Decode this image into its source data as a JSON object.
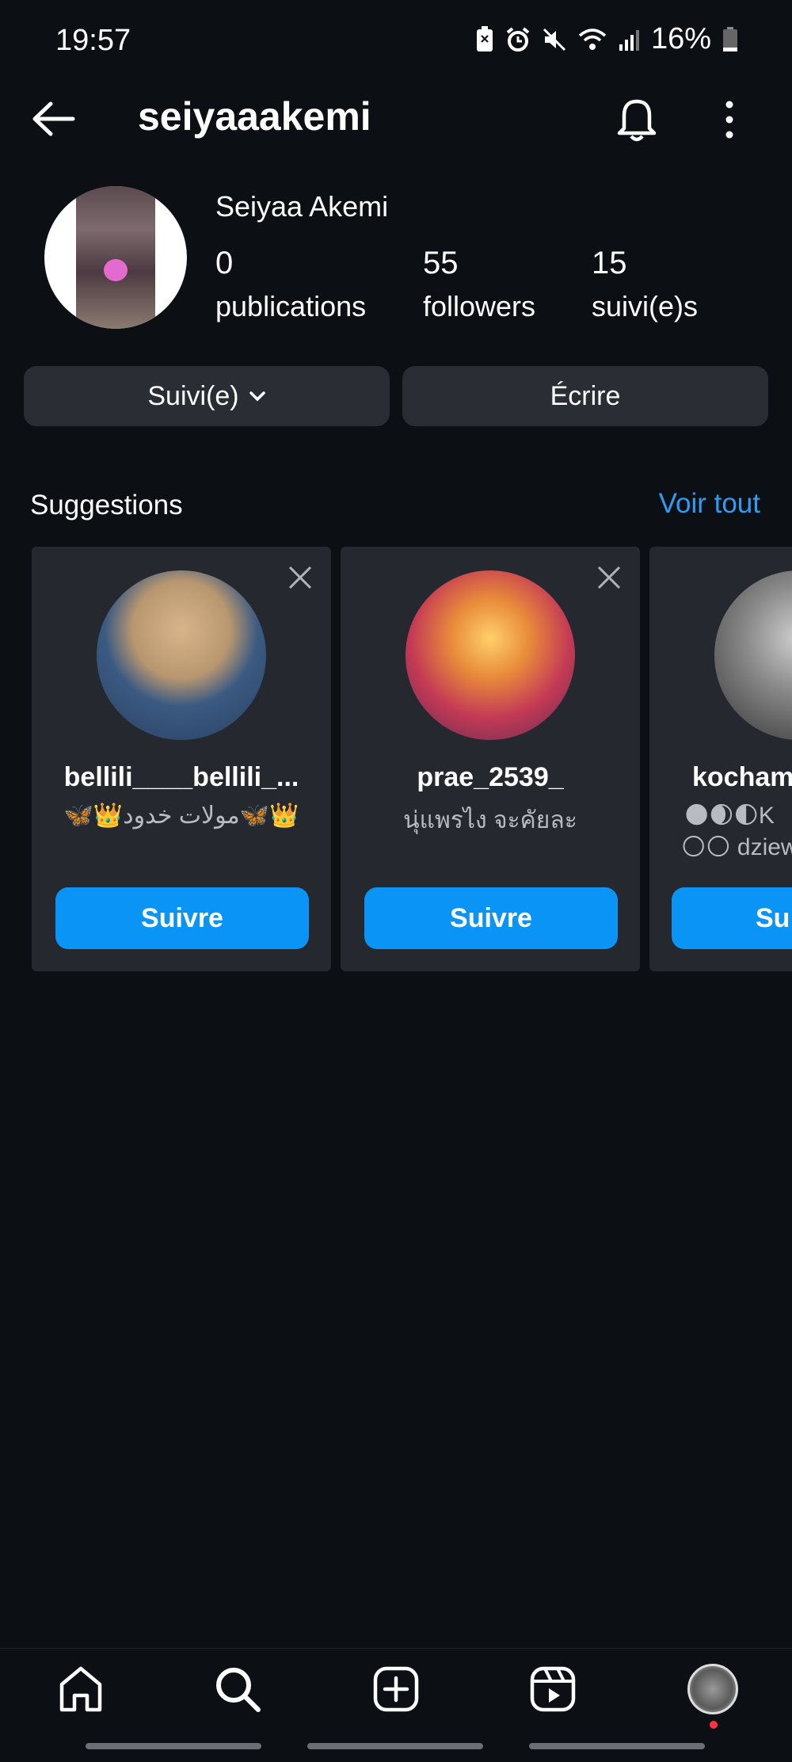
{
  "status_bar": {
    "time": "19:57",
    "battery": "16%"
  },
  "header": {
    "username": "seiyaaakemi"
  },
  "profile": {
    "full_name": "Seiyaa Akemi",
    "stats": [
      {
        "value": "0",
        "label": "publications"
      },
      {
        "value": "55",
        "label": "followers"
      },
      {
        "value": "15",
        "label": "suivi(e)s"
      }
    ]
  },
  "actions": {
    "follow_state": "Suivi(e)",
    "message": "Écrire"
  },
  "suggestions": {
    "title": "Suggestions",
    "see_all": "Voir tout",
    "cards": [
      {
        "username": "bellili____bellili_...",
        "bio": "🦋👑مولات خدود🦋👑",
        "button": "Suivre"
      },
      {
        "username": "prae_2539_",
        "bio": "นุ่แพรไง จะคัยละ",
        "button": "Suivre"
      },
      {
        "username": "kocham",
        "bio": "🌑🌒🌓K",
        "bio2": "🌕🌕 dziew",
        "button": "Su"
      }
    ]
  },
  "colors": {
    "accent": "#0a95f6",
    "link": "#2e9cf0",
    "background": "#0c0f14",
    "card": "#25282e"
  },
  "nav": {
    "items": [
      "home-icon",
      "search-icon",
      "create-icon",
      "reels-icon",
      "profile-avatar"
    ]
  }
}
